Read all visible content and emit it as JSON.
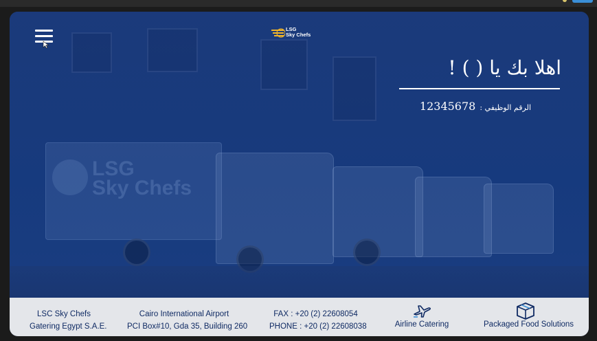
{
  "header": {
    "brand_line1": "LSG",
    "brand_line2": "Sky Chefs"
  },
  "background": {
    "truck_logo_line1": "LSG",
    "truck_logo_line2": "Sky Chefs"
  },
  "welcome": {
    "greeting": "اهلا بك يا (      ) !",
    "employee_id_label": "الرقم الوظيفي :",
    "employee_id_value": "12345678"
  },
  "footer": {
    "company_line1": "LSC Sky Chefs",
    "company_line2": "Gatering Egypt S.A.E.",
    "address_line1": "Cairo International Airport",
    "address_line2": "PCI Box#10, Gda 35, Building 260",
    "fax": "FAX : +20 (2) 22608054",
    "phone": "PHONE : +20 (2) 22608038",
    "service1_label": "Airline Catering",
    "service1_icon": "airplane-icon",
    "service2_label": "Packaged Food Solutions",
    "service2_icon": "package-box-icon"
  },
  "colors": {
    "hero_blue": "#163a7e",
    "footer_bg": "#e4e6ea",
    "footer_text": "#0f2a63",
    "logo_gold": "#f0b429"
  }
}
